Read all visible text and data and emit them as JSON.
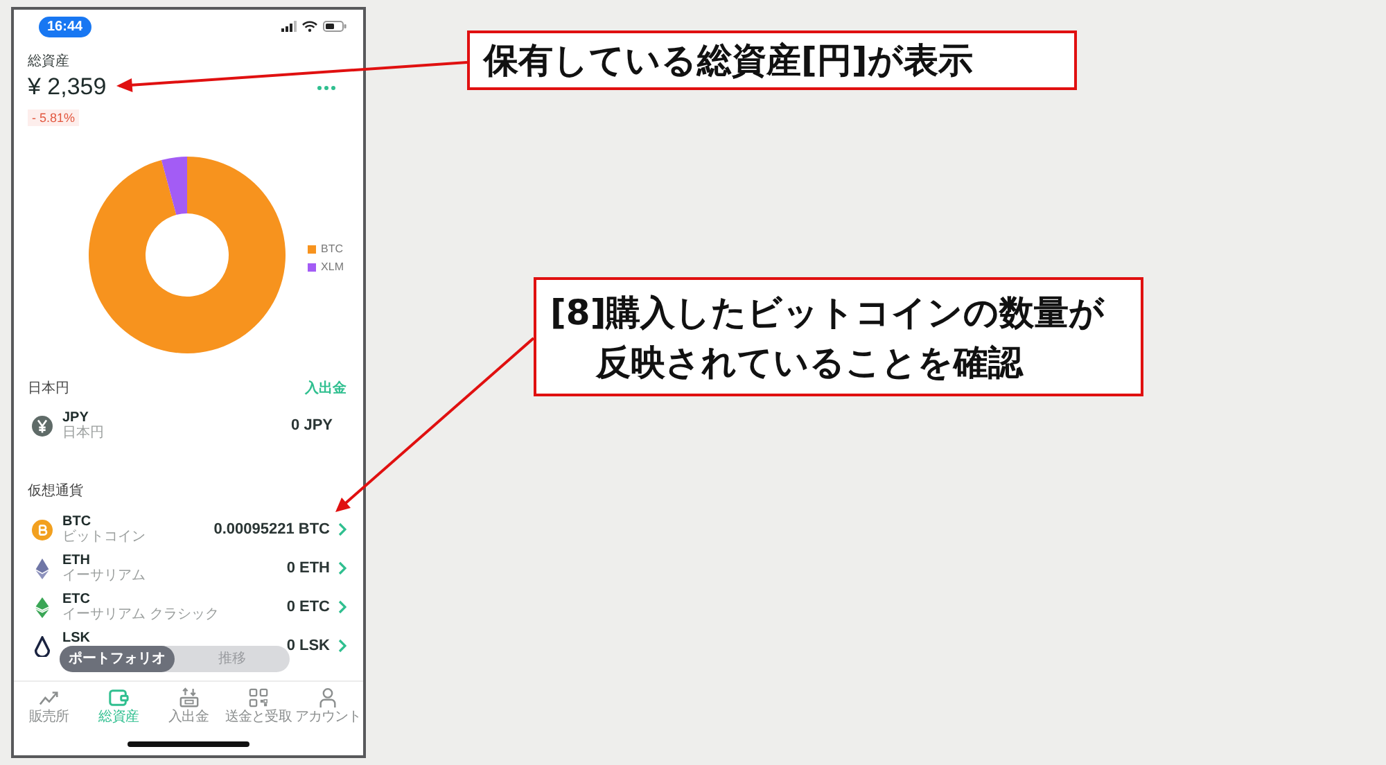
{
  "status_bar": {
    "time": "16:44"
  },
  "summary": {
    "label": "総資産",
    "total": "¥ 2,359",
    "change": "- 5.81%"
  },
  "allocation_chart": {
    "legend": [
      {
        "label": "BTC",
        "color": "#f7931e"
      },
      {
        "label": "XLM",
        "color": "#a35cf5"
      }
    ]
  },
  "jpy_section": {
    "title": "日本円",
    "action": "入出金",
    "assets": [
      {
        "symbol": "JPY",
        "name": "日本円",
        "amount": "0 JPY"
      }
    ]
  },
  "crypto_section": {
    "title": "仮想通貨",
    "assets": [
      {
        "symbol": "BTC",
        "name": "ビットコイン",
        "amount": "0.00095221 BTC"
      },
      {
        "symbol": "ETH",
        "name": "イーサリアム",
        "amount": "0 ETH"
      },
      {
        "symbol": "ETC",
        "name": "イーサリアム クラシック",
        "amount": "0 ETC"
      },
      {
        "symbol": "LSK",
        "amount": "0 LSK"
      }
    ]
  },
  "view_toggle": [
    {
      "label": "ポートフォリオ",
      "selected": true
    },
    {
      "label": "推移",
      "selected": false
    }
  ],
  "tab_bar": [
    {
      "label": "販売所",
      "selected": false
    },
    {
      "label": "総資産",
      "selected": true
    },
    {
      "label": "入出金",
      "selected": false
    },
    {
      "label": "送金と受取",
      "selected": false
    },
    {
      "label": "アカウント",
      "selected": false
    }
  ],
  "annotations": [
    {
      "text": "保有している総資産[円]が表示"
    },
    {
      "text": "[8]購入したビットコインの数量が反映されていることを確認"
    }
  ]
}
